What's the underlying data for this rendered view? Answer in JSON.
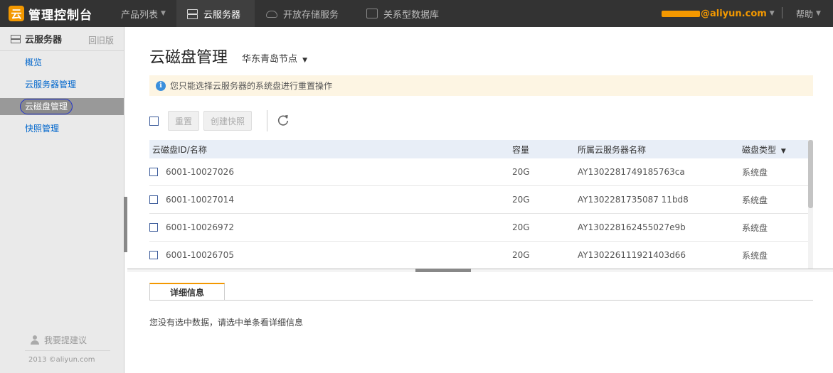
{
  "topbar": {
    "logo_glyph": "云",
    "logo_text": "管理控制台",
    "nav": {
      "products": "产品列表",
      "ecs": "云服务器",
      "oss": "开放存储服务",
      "rds": "关系型数据库"
    },
    "user_email_suffix": "@aliyun.com",
    "help": "帮助"
  },
  "sidebar": {
    "title": "云服务器",
    "old_version": "回旧版",
    "items": [
      {
        "label": "概览"
      },
      {
        "label": "云服务器管理"
      },
      {
        "label": "云磁盘管理"
      },
      {
        "label": "快照管理"
      }
    ],
    "suggest": "我要提建议",
    "copyright": "2013 ©aliyun.com"
  },
  "main": {
    "title": "云磁盘管理",
    "region": "华东青岛节点",
    "notice": "您只能选择云服务器的系统盘进行重置操作",
    "toolbar": {
      "reset": "重置",
      "create_snapshot": "创建快照"
    },
    "table": {
      "headers": {
        "id": "云磁盘ID/名称",
        "capacity": "容量",
        "server": "所属云服务器名称",
        "type": "磁盘类型"
      },
      "rows": [
        {
          "id": "6001-10027026",
          "capacity": "20G",
          "server": "AY1302281749185763ca",
          "type": "系统盘"
        },
        {
          "id": "6001-10027014",
          "capacity": "20G",
          "server": "AY1302281735087 11bd8",
          "type": "系统盘"
        },
        {
          "id": "6001-10026972",
          "capacity": "20G",
          "server": "AY130228162455027e9b",
          "type": "系统盘"
        },
        {
          "id": "6001-10026705",
          "capacity": "20G",
          "server": "AY130226111921403d66",
          "type": "系统盘"
        }
      ]
    },
    "detail": {
      "tab": "详细信息",
      "empty": "您没有选中数据，请选中单条看详细信息"
    }
  },
  "colors": {
    "accent": "#f39800",
    "link": "#0066cc",
    "topbar": "#333333"
  }
}
